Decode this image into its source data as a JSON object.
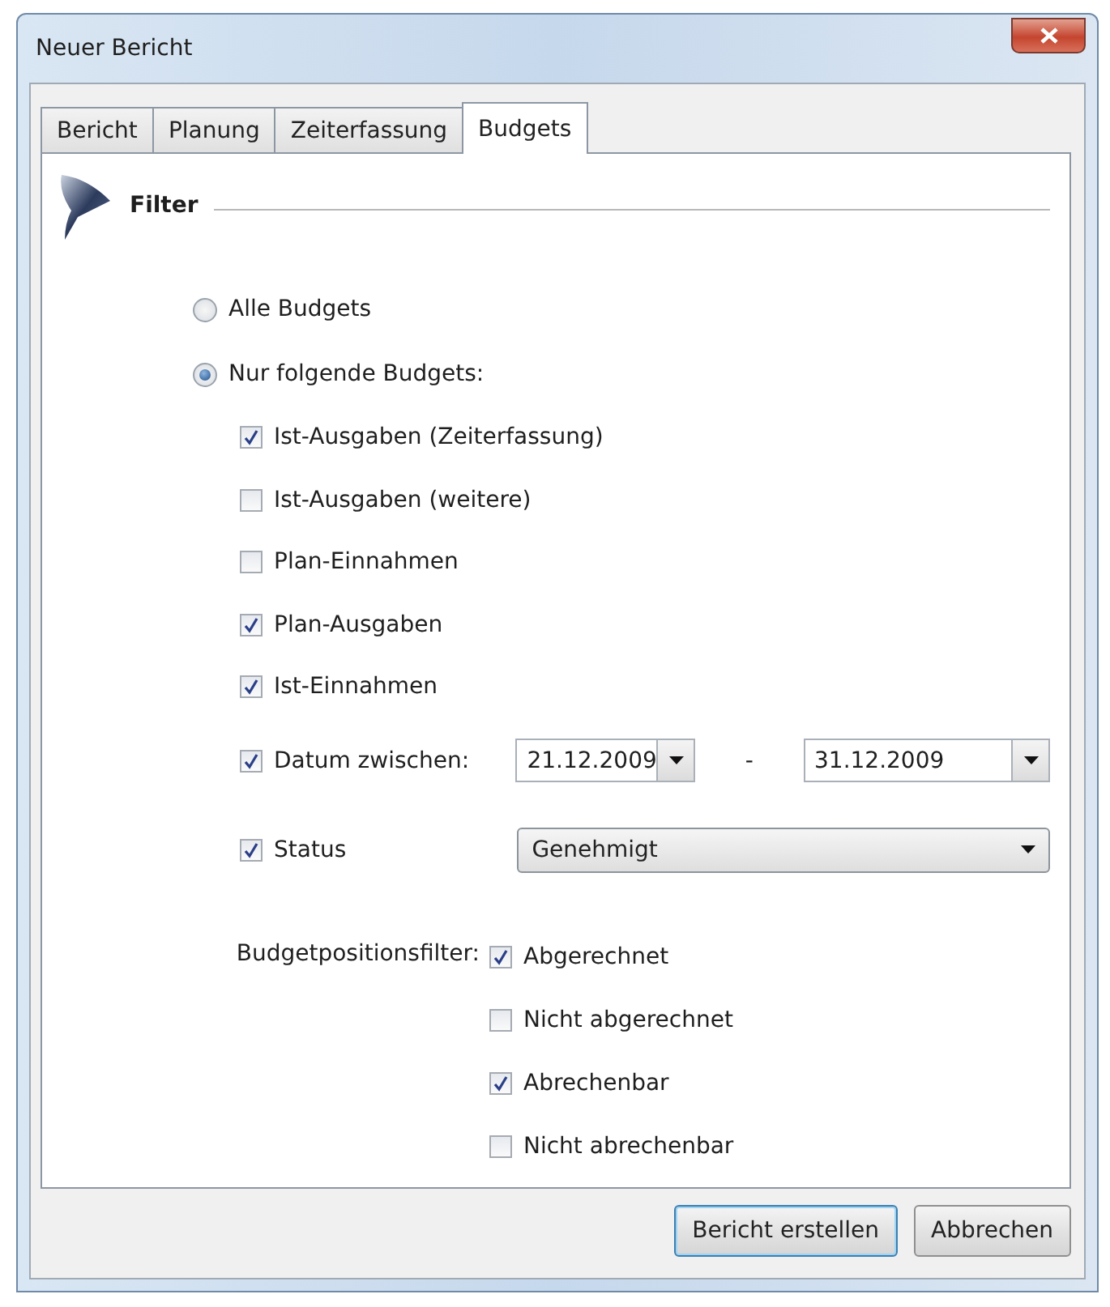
{
  "window": {
    "title": "Neuer Bericht"
  },
  "tabs": [
    {
      "label": "Bericht",
      "selected": false
    },
    {
      "label": "Planung",
      "selected": false
    },
    {
      "label": "Zeiterfassung",
      "selected": false
    },
    {
      "label": "Budgets",
      "selected": true
    }
  ],
  "filter": {
    "heading": "Filter"
  },
  "scope": [
    {
      "label": "Alle Budgets",
      "selected": false
    },
    {
      "label": "Nur folgende Budgets:",
      "selected": true
    }
  ],
  "budget_types": [
    {
      "label": "Ist-Ausgaben (Zeiterfassung)",
      "checked": true
    },
    {
      "label": "Ist-Ausgaben (weitere)",
      "checked": false
    },
    {
      "label": "Plan-Einnahmen",
      "checked": false
    },
    {
      "label": "Plan-Ausgaben",
      "checked": true
    },
    {
      "label": "Ist-Einnahmen",
      "checked": true
    }
  ],
  "date_filter": {
    "label": "Datum zwischen:",
    "checked": true,
    "from": "21.12.2009",
    "separator": "-",
    "to": "31.12.2009"
  },
  "status_filter": {
    "label": "Status",
    "checked": true,
    "value": "Genehmigt"
  },
  "position_filter": {
    "label": "Budgetpositionsfilter:",
    "options": [
      {
        "label": "Abgerechnet",
        "checked": true
      },
      {
        "label": "Nicht abgerechnet",
        "checked": false
      },
      {
        "label": "Abrechenbar",
        "checked": true
      },
      {
        "label": "Nicht abrechenbar",
        "checked": false
      }
    ]
  },
  "buttons": [
    {
      "label": "Bericht erstellen",
      "default": true
    },
    {
      "label": "Abbrechen",
      "default": false
    }
  ]
}
